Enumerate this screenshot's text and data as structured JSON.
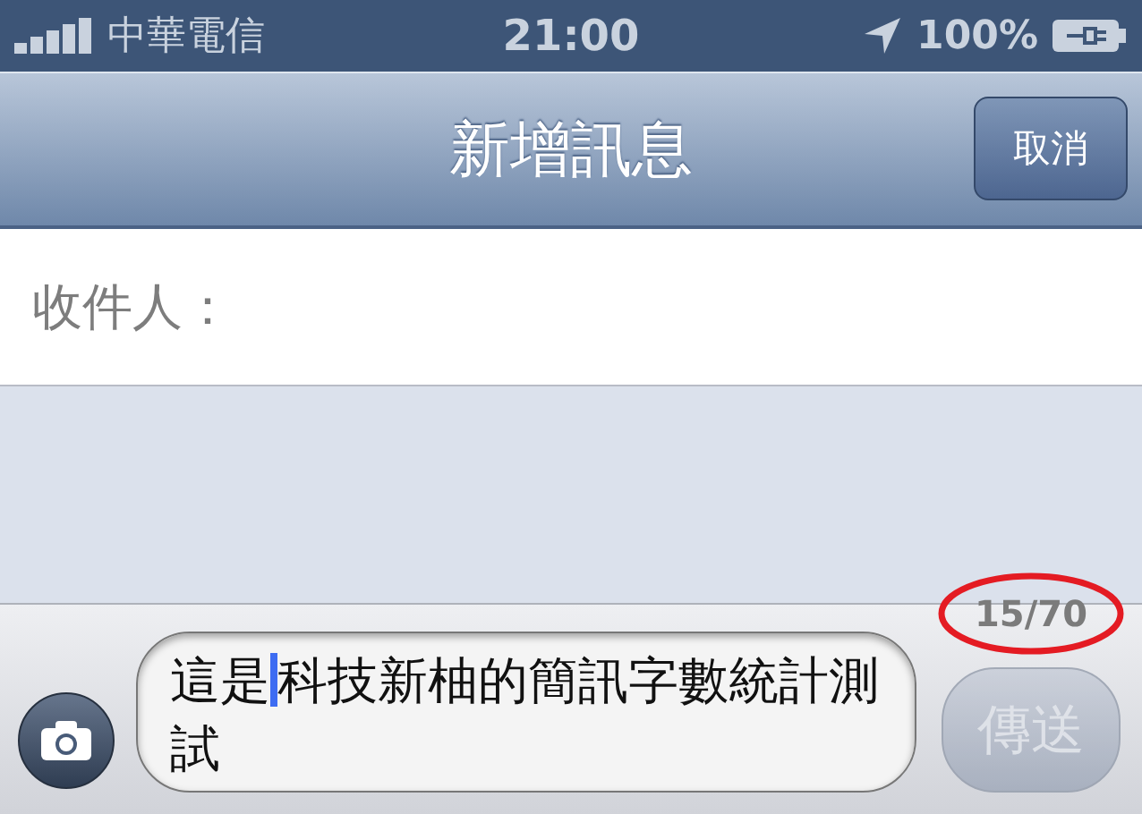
{
  "status_bar": {
    "carrier": "中華電信",
    "time": "21:00",
    "battery": "100%"
  },
  "nav_bar": {
    "title": "新增訊息",
    "cancel_button": "取消"
  },
  "recipient": {
    "label": "收件人："
  },
  "composer": {
    "text_before_cursor": "這是",
    "text_after_cursor": "科技新柚的簡訊字數統計測試",
    "counter": {
      "text": "15/70",
      "circled": true
    },
    "send_button": {
      "label": "傳送",
      "disabled": true
    }
  }
}
